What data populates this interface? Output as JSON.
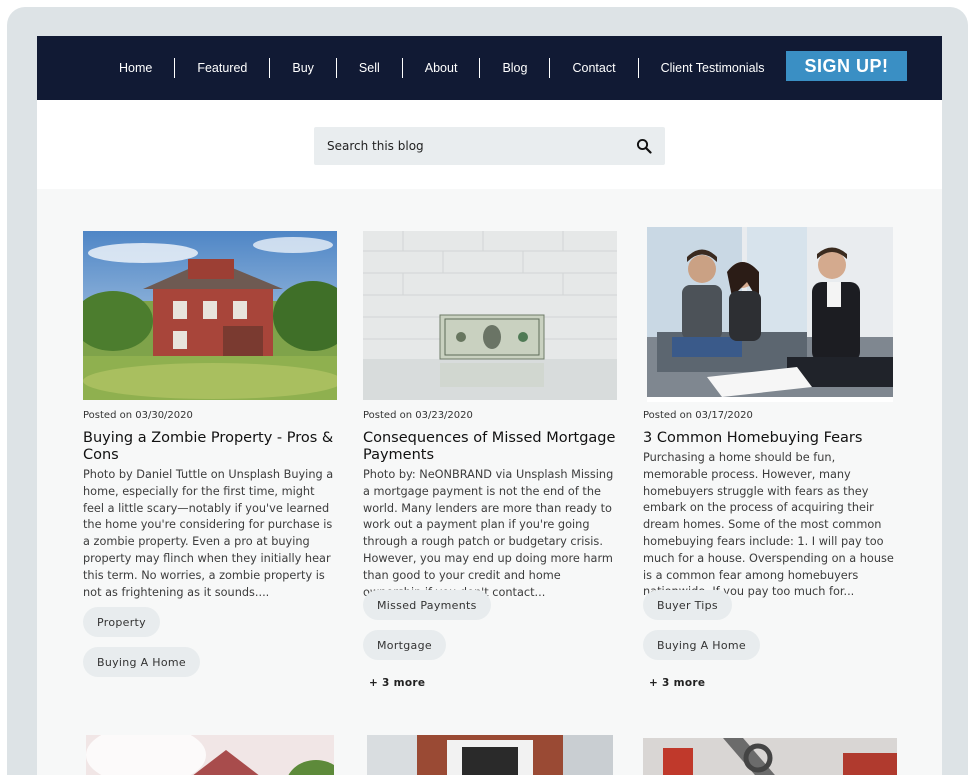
{
  "nav": {
    "items": [
      "Home",
      "Featured",
      "Buy",
      "Sell",
      "About",
      "Blog",
      "Contact",
      "Client Testimonials"
    ],
    "signup_label": "SIGN UP!"
  },
  "search": {
    "placeholder": "Search this blog"
  },
  "posts": [
    {
      "posted": "Posted on 03/30/2020",
      "title": "Buying a Zombie Property - Pros & Cons",
      "excerpt": "Photo by Daniel Tuttle on Unsplash Buying a home, especially for the first time, might feel a little scary—notably if you've learned the home you're considering for purchase is a zombie property. Even a pro at buying property may flinch when they initially hear this term. No worries, a zombie property is not as frightening as it sounds....",
      "tags": [
        "Property",
        "Buying A Home"
      ],
      "more": ""
    },
    {
      "posted": "Posted on 03/23/2020",
      "title": "Consequences of Missed Mortgage Payments",
      "excerpt": "Photo by: NeONBRAND via Unsplash Missing a mortgage payment is not the end of the world. Many lenders are more than ready to work out a payment plan if you're going through a rough patch or budgetary crisis. However, you may end up doing more harm than good to your credit and home ownership if you don't contact...",
      "tags": [
        "Missed Payments",
        "Mortgage"
      ],
      "more": "+ 3 more"
    },
    {
      "posted": "Posted on 03/17/2020",
      "title": "3 Common Homebuying Fears",
      "excerpt": "Purchasing a home should be fun, memorable process. However, many homebuyers struggle with fears as they embark on the process of acquiring their dream homes. Some of the most common homebuying fears include: 1. I will pay too much for a house. Overspending on a house is a common fear among homebuyers nationwide. If you pay too much for...",
      "tags": [
        "Buyer Tips",
        "Buying A Home"
      ],
      "more": "+ 3 more"
    }
  ],
  "colors": {
    "nav_bg": "#111a34",
    "signup_bg": "#3a8fc4",
    "tag_bg": "#e8ecee",
    "frame": "#dde3e6"
  }
}
